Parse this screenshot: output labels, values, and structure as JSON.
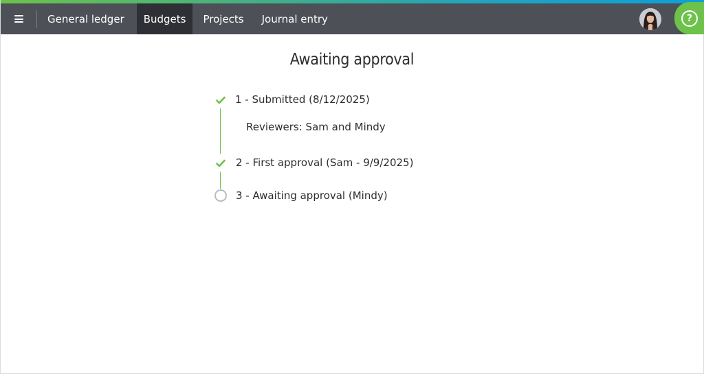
{
  "navbar": {
    "tabs": [
      {
        "label": "General ledger",
        "active": false
      },
      {
        "label": "Budgets",
        "active": true
      },
      {
        "label": "Projects",
        "active": false
      },
      {
        "label": "Journal entry",
        "active": false
      }
    ],
    "menu_icon": "hamburger-menu-icon",
    "help_icon": "question-mark-icon",
    "help_glyph": "?"
  },
  "colors": {
    "navbar_bg": "#4e5058",
    "active_tab_bg": "#2f3035",
    "accent_green": "#6cc24a",
    "pending_circle": "#b9bcc2"
  },
  "main": {
    "title": "Awaiting approval",
    "steps": [
      {
        "label": "1 - Submitted (8/12/2025)",
        "status": "complete",
        "detail": "Reviewers: Sam and Mindy"
      },
      {
        "label": "2 - First approval (Sam - 9/9/2025)",
        "status": "complete"
      },
      {
        "label": "3 - Awaiting approval (Mindy)",
        "status": "pending"
      }
    ]
  }
}
